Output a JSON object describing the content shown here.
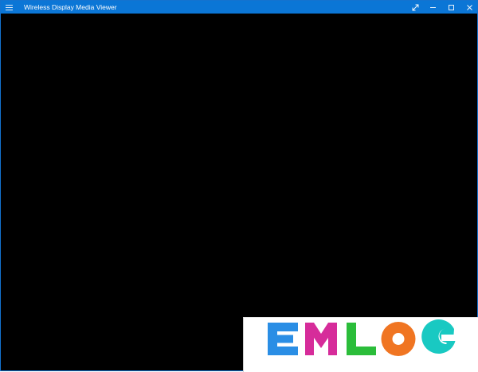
{
  "window": {
    "title": "Wireless Display Media Viewer",
    "accent_color": "#0b76d6",
    "content_color": "#000000"
  },
  "titlebar": {
    "menu_icon": "hamburger-icon",
    "buttons": [
      {
        "name": "fullscreen",
        "icon": "expand-diagonal-icon"
      },
      {
        "name": "minimize",
        "icon": "minimize-icon"
      },
      {
        "name": "maximize",
        "icon": "maximize-icon"
      },
      {
        "name": "close",
        "icon": "close-icon"
      }
    ]
  },
  "watermark": {
    "text": "EMLOG",
    "letters": [
      {
        "char": "E",
        "color": "#2a8ee5"
      },
      {
        "char": "M",
        "color": "#d62c9a"
      },
      {
        "char": "L",
        "color": "#2bbd3a"
      },
      {
        "char": "O",
        "color": "#f07522"
      },
      {
        "char": "G",
        "color": "#19c9c2"
      }
    ]
  }
}
